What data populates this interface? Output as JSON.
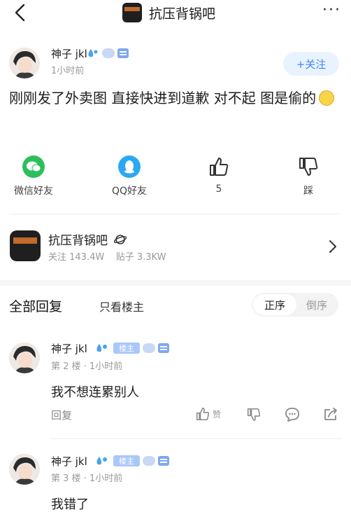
{
  "header": {
    "title": "抗压背锅吧",
    "more": "···"
  },
  "post": {
    "author": "神子 jkl",
    "time": "1小时前",
    "follow_label": "+关注",
    "text": "刚刚发了外卖图 直接快进到道歉 对不起 图是偷的"
  },
  "share_bar": [
    {
      "label": "微信好友",
      "icon": "wechat-icon",
      "color": "#2dbf5b"
    },
    {
      "label": "QQ好友",
      "icon": "qq-icon",
      "color": "#2aa8f2"
    },
    {
      "label": "5",
      "icon": "thumb-up-icon"
    },
    {
      "label": "踩",
      "icon": "thumb-down-icon"
    }
  ],
  "forum": {
    "name": "抗压背锅吧",
    "followers": "关注 143.4W",
    "posts": "贴子 3.3KW"
  },
  "tabs": {
    "all": "全部回复",
    "only_op": "只看楼主",
    "sort_selected": "正序",
    "sort_other": "倒序"
  },
  "replies": [
    {
      "author": "神子 jkl",
      "badge": "楼主",
      "meta": "第 2 楼 · 1小时前",
      "text": "我不想连累别人",
      "reply_label": "回复",
      "like_label": "赞"
    },
    {
      "author": "神子 jkl",
      "badge": "楼主",
      "meta": "第 3 楼 · 1小时前",
      "text": "我错了"
    }
  ],
  "colors": {
    "accent": "#3f86f3",
    "badge": "#a9c7fb"
  }
}
